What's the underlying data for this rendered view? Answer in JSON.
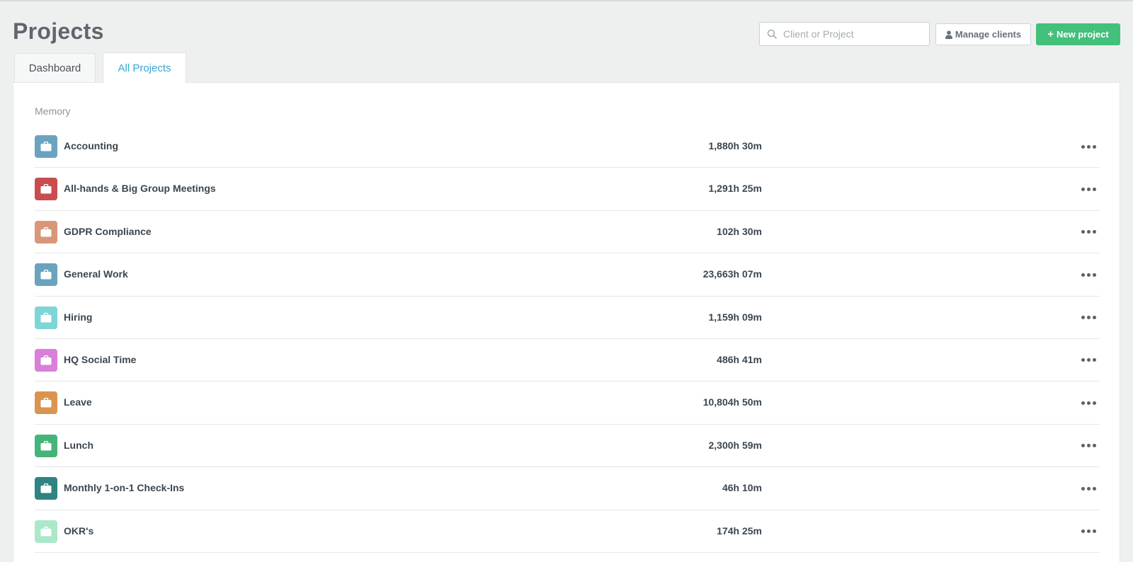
{
  "header": {
    "title": "Projects",
    "search_placeholder": "Client or Project",
    "manage_clients_label": "Manage clients",
    "new_project_label": "New project"
  },
  "tabs": [
    {
      "label": "Dashboard",
      "active": false
    },
    {
      "label": "All Projects",
      "active": true
    }
  ],
  "group": {
    "label": "Memory",
    "projects": [
      {
        "name": "Accounting",
        "hours": "1,880h 30m",
        "color": "#6aa3c0",
        "icon": "briefcase-icon"
      },
      {
        "name": "All-hands & Big Group Meetings",
        "hours": "1,291h 25m",
        "color": "#c94d4f",
        "icon": "briefcase-icon"
      },
      {
        "name": "GDPR Compliance",
        "hours": "102h 30m",
        "color": "#d99679",
        "icon": "briefcase-icon"
      },
      {
        "name": "General Work",
        "hours": "23,663h 07m",
        "color": "#6aa3c0",
        "icon": "briefcase-icon"
      },
      {
        "name": "Hiring",
        "hours": "1,159h 09m",
        "color": "#7dd5d6",
        "icon": "briefcase-icon"
      },
      {
        "name": "HQ Social Time",
        "hours": "486h 41m",
        "color": "#d77fd9",
        "icon": "briefcase-icon"
      },
      {
        "name": "Leave",
        "hours": "10,804h 50m",
        "color": "#d9954f",
        "icon": "briefcase-icon"
      },
      {
        "name": "Lunch",
        "hours": "2,300h 59m",
        "color": "#46b47a",
        "icon": "briefcase-icon"
      },
      {
        "name": "Monthly 1-on-1 Check-Ins",
        "hours": "46h 10m",
        "color": "#2f8382",
        "icon": "briefcase-icon"
      },
      {
        "name": "OKR's",
        "hours": "174h 25m",
        "color": "#a9e8c9",
        "icon": "briefcase-icon"
      }
    ]
  },
  "icons": {
    "search": "search-icon",
    "manage_clients": "user-icon",
    "new_project": "plus-icon",
    "row_menu": "more-dots-icon"
  },
  "colors": {
    "accent": "#3aa6cf",
    "new_button": "#43c07a"
  }
}
